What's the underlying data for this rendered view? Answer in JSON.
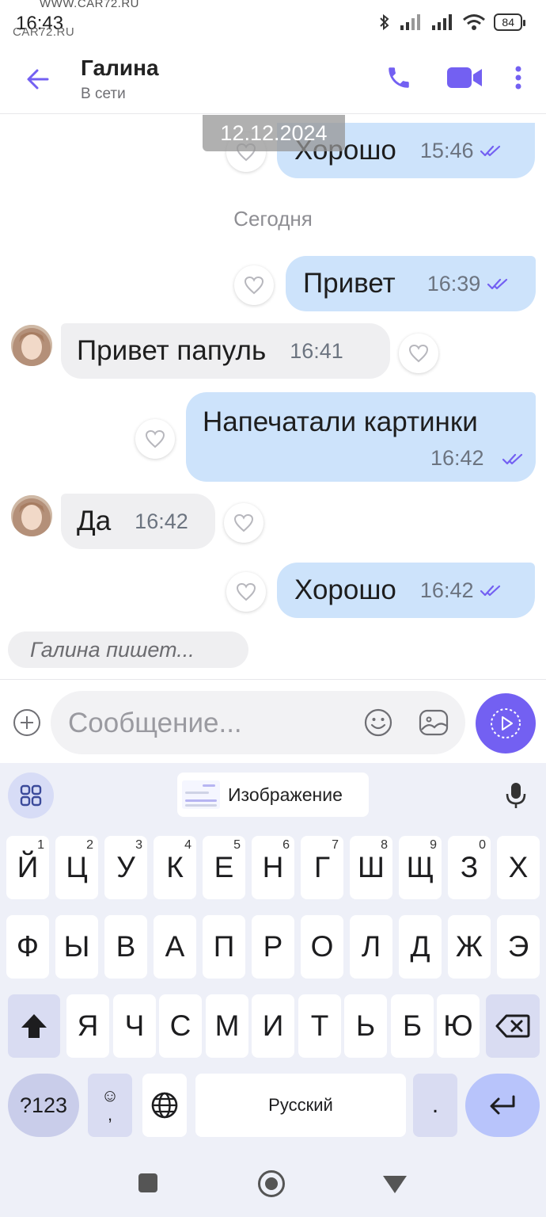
{
  "status_bar": {
    "time": "16:43",
    "watermark_top": "WWW.CAR72.RU",
    "watermark_bottom": "CAR72.RU",
    "battery": "84"
  },
  "header": {
    "contact_name": "Галина",
    "contact_status": "В сети"
  },
  "chat": {
    "date_chip": "12.12.2024",
    "day_separator": "Сегодня",
    "messages": [
      {
        "direction": "out",
        "text": "Хорошо",
        "time": "15:46",
        "status": "read"
      },
      {
        "direction": "out",
        "text": "Привет",
        "time": "16:39",
        "status": "read"
      },
      {
        "direction": "in",
        "text": "Привет папуль",
        "time": "16:41"
      },
      {
        "direction": "out",
        "text": "Напечатали картинки",
        "time": "16:42",
        "status": "read"
      },
      {
        "direction": "in",
        "text": "Да",
        "time": "16:42"
      },
      {
        "direction": "out",
        "text": "Хорошо",
        "time": "16:42",
        "status": "read"
      }
    ],
    "typing_indicator": "Галина пишет..."
  },
  "composer": {
    "placeholder": "Сообщение..."
  },
  "keyboard": {
    "suggestion": "Изображение",
    "row1": [
      {
        "key": "Й",
        "hint": "1"
      },
      {
        "key": "Ц",
        "hint": "2"
      },
      {
        "key": "У",
        "hint": "3"
      },
      {
        "key": "К",
        "hint": "4"
      },
      {
        "key": "Е",
        "hint": "5"
      },
      {
        "key": "Н",
        "hint": "6"
      },
      {
        "key": "Г",
        "hint": "7"
      },
      {
        "key": "Ш",
        "hint": "8"
      },
      {
        "key": "Щ",
        "hint": "9"
      },
      {
        "key": "З",
        "hint": "0"
      },
      {
        "key": "Х",
        "hint": ""
      }
    ],
    "row2": [
      "Ф",
      "Ы",
      "В",
      "А",
      "П",
      "Р",
      "О",
      "Л",
      "Д",
      "Ж",
      "Э"
    ],
    "row3": [
      "Я",
      "Ч",
      "С",
      "М",
      "И",
      "Т",
      "Ь",
      "Б",
      "Ю"
    ],
    "symbols_label": "?123",
    "emoji_glyph": "☺",
    "comma": ",",
    "space_label": "Русский",
    "dot": "."
  },
  "colors": {
    "accent": "#7360f2",
    "outgoing_bubble": "#cde3fb",
    "incoming_bubble": "#efeff1",
    "read_ticks": "#7360f2"
  },
  "icons": {
    "back": "arrow-left-icon",
    "call": "phone-icon",
    "video": "video-camera-icon",
    "more": "more-vertical-icon",
    "like": "heart-outline-icon",
    "attach": "plus-circle-icon",
    "emoji": "smiley-icon",
    "sticker": "sticker-icon",
    "send": "video-message-icon",
    "apps": "grid-icon",
    "mic": "microphone-icon",
    "shift": "shift-arrow-icon",
    "backspace": "backspace-icon",
    "globe": "globe-icon",
    "enter": "enter-arrow-icon"
  }
}
